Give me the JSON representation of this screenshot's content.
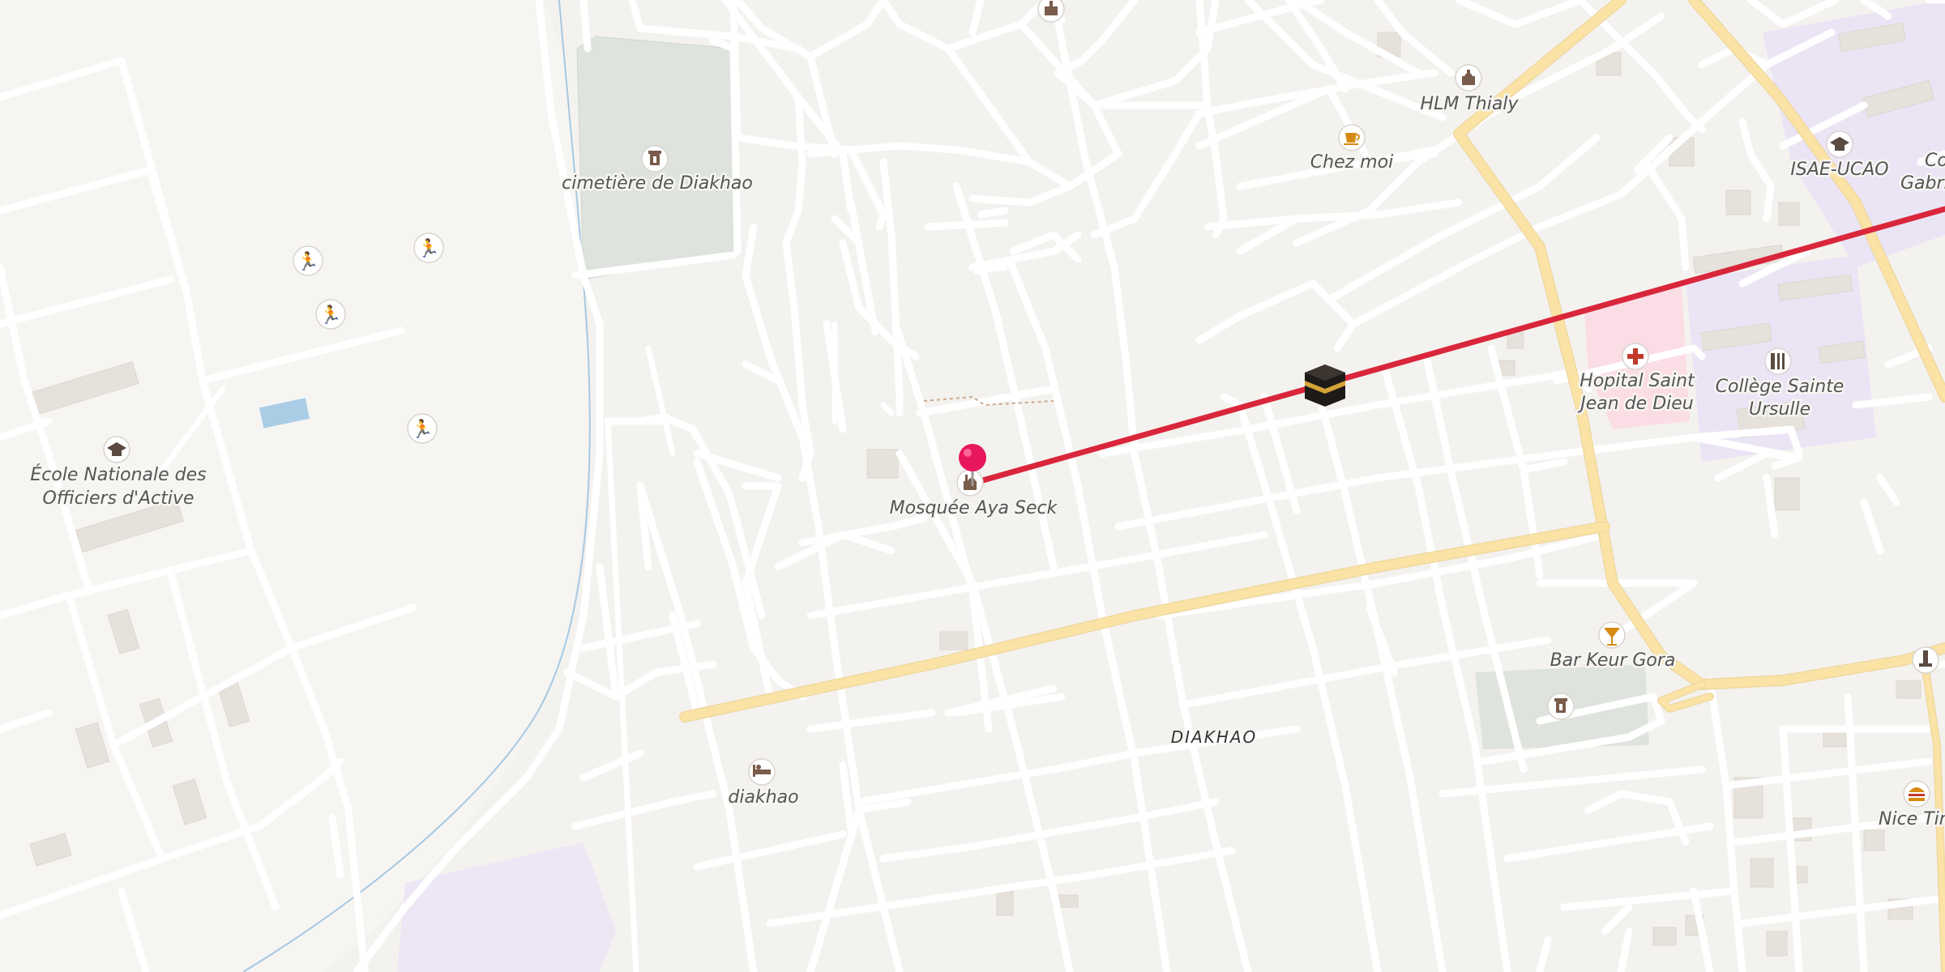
{
  "map": {
    "area_label": "DIAKHAO",
    "colors": {
      "background": "#f4f2ef",
      "route": "#d9263b",
      "marker": "#e8175d",
      "major_road": "#fbe3a6",
      "cemetery": "#dfe3dd",
      "hospital": "#fbdde5",
      "school": "#ebe4f5"
    },
    "pois": [
      {
        "id": "cemetery",
        "label": "cimetière de Diakhao",
        "icon": "cemetery-icon"
      },
      {
        "id": "hlm",
        "label": "HLM Thialy",
        "icon": "mosque-icon"
      },
      {
        "id": "chezmoi",
        "label": "Chez moi",
        "icon": "cafe-icon"
      },
      {
        "id": "isae",
        "label": "ISAE-UCAO",
        "icon": "school-icon"
      },
      {
        "id": "college_gab",
        "label": "Collè",
        "label2": "Gabri",
        "icon": "school-icon"
      },
      {
        "id": "hospital",
        "label": "Hopital Saint",
        "label2": "Jean de Dieu",
        "icon": "hospital-icon"
      },
      {
        "id": "ursulle",
        "label": "Collège Sainte",
        "label2": "Ursulle",
        "icon": "school-icon"
      },
      {
        "id": "ecole",
        "label": "École Nationale des",
        "label2": "Officiers d'Active",
        "icon": "school-icon"
      },
      {
        "id": "mosquee",
        "label": "Mosquée Aya Seck",
        "icon": "mosque-icon"
      },
      {
        "id": "bar",
        "label": "Bar Keur Gora",
        "icon": "bar-icon"
      },
      {
        "id": "hotel",
        "label": "diakhao",
        "icon": "hotel-icon"
      },
      {
        "id": "nice",
        "label": "Nice Tim",
        "icon": "fastfood-icon"
      }
    ]
  }
}
